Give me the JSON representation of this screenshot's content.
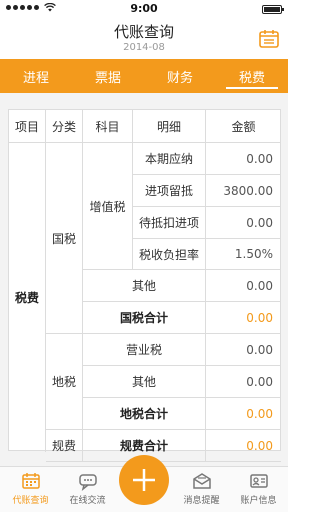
{
  "status_bar": {
    "time": "9:00"
  },
  "header": {
    "title": "代账查询",
    "subtitle": "2014-08"
  },
  "tabs": [
    {
      "label": "进程",
      "active": false
    },
    {
      "label": "票据",
      "active": false
    },
    {
      "label": "财务",
      "active": false
    },
    {
      "label": "税费",
      "active": true
    }
  ],
  "table": {
    "headers": [
      "项目",
      "分类",
      "科目",
      "明细",
      "金额"
    ],
    "project": "税费",
    "categories": {
      "guoshui": "国税",
      "dishui": "地税",
      "guifei": "规费"
    },
    "subject_vat": "增值税",
    "vat_rows": [
      {
        "label": "本期应纳",
        "amount": "0.00"
      },
      {
        "label": "进项留抵",
        "amount": "3800.00"
      },
      {
        "label": "待抵扣进项",
        "amount": "0.00"
      },
      {
        "label": "税收负担率",
        "amount": "1.50%"
      }
    ],
    "guoshui_other": {
      "label": "其他",
      "amount": "0.00"
    },
    "guoshui_total": {
      "label": "国税合计",
      "amount": "0.00"
    },
    "dishui_business": {
      "label": "营业税",
      "amount": "0.00"
    },
    "dishui_other": {
      "label": "其他",
      "amount": "0.00"
    },
    "dishui_total": {
      "label": "地税合计",
      "amount": "0.00"
    },
    "guifei_total": {
      "label": "规费合计",
      "amount": "0.00"
    }
  },
  "bottom_nav": [
    {
      "label": "代账查询",
      "icon": "calendar-icon",
      "active": true
    },
    {
      "label": "在线交流",
      "icon": "chat-icon",
      "active": false
    },
    {
      "label": "",
      "icon": "plus-icon",
      "active": false
    },
    {
      "label": "消息提醒",
      "icon": "mail-icon",
      "active": false
    },
    {
      "label": "账户信息",
      "icon": "id-card-icon",
      "active": false
    }
  ],
  "colors": {
    "accent": "#f39a1c",
    "grid": "#dcdcdc",
    "background": "#f3f3f3"
  }
}
